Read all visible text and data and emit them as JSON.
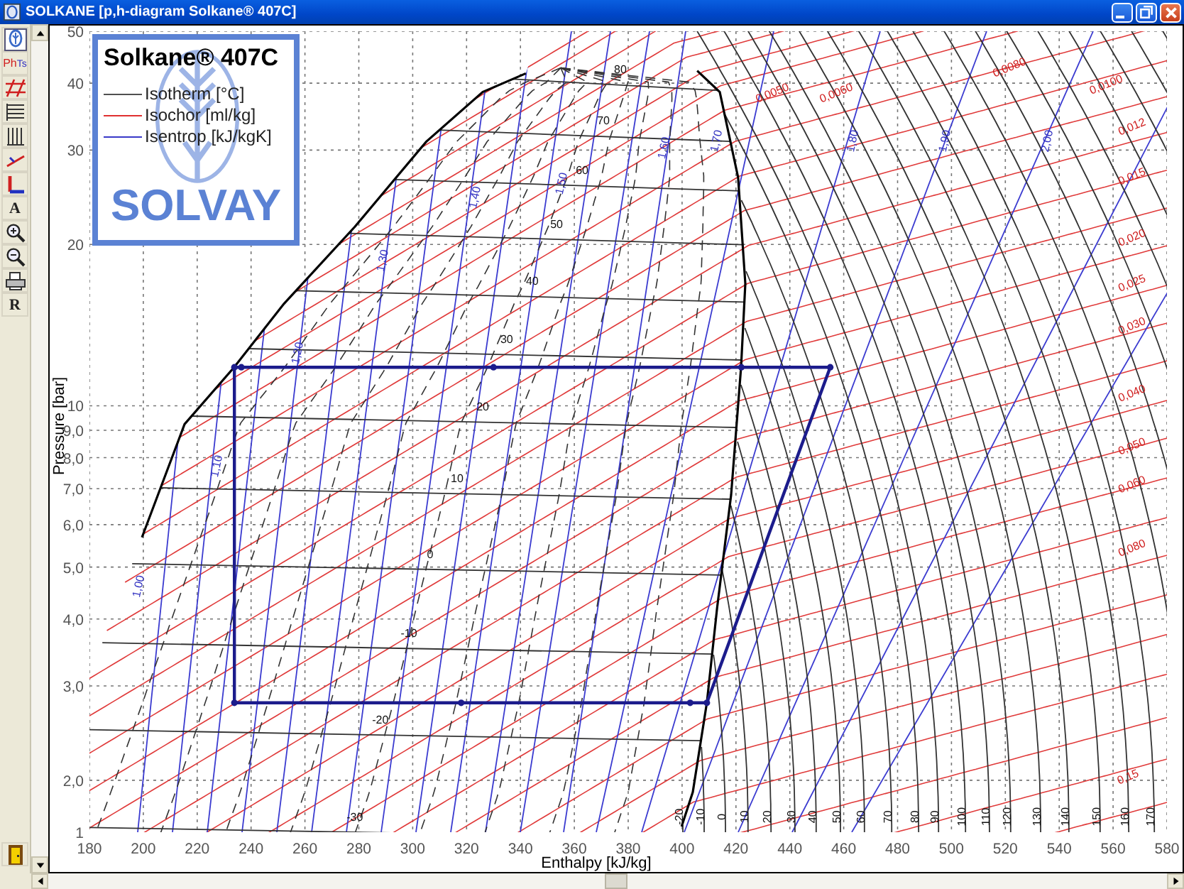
{
  "window": {
    "title": "SOLKANE [p,h-diagram Solkane® 407C]"
  },
  "toolbar": {
    "items": [
      {
        "kind": "logo"
      },
      {
        "kind": "ph_ts",
        "labels": [
          "Ph",
          "Ts"
        ]
      },
      {
        "kind": "isolines"
      },
      {
        "kind": "horizontal"
      },
      {
        "kind": "vertical"
      },
      {
        "kind": "slope"
      },
      {
        "kind": "axes"
      },
      {
        "kind": "text",
        "label": "A"
      },
      {
        "kind": "zoom_in"
      },
      {
        "kind": "zoom_out"
      },
      {
        "kind": "print"
      },
      {
        "kind": "text",
        "label": "R"
      }
    ],
    "bottom_items": [
      {
        "kind": "exit"
      }
    ]
  },
  "legend": {
    "title": "Solkane® 407C",
    "brand": "SOLVAY",
    "items": [
      {
        "label": "Isotherm [°C]",
        "color": "#505050"
      },
      {
        "label": "Isochor [ml/kg]",
        "color": "#e03030"
      },
      {
        "label": "Isentrop [kJ/kgK]",
        "color": "#3838c8"
      }
    ]
  },
  "chart": {
    "x_axis_title": "Enthalpy [kJ/kg]",
    "y_axis_title": "Pressure [bar]",
    "x_axis_labels": [
      "180",
      "200",
      "220",
      "240",
      "260",
      "280",
      "300",
      "320",
      "340",
      "360",
      "380",
      "400",
      "420",
      "440",
      "460",
      "480",
      "500",
      "520",
      "540",
      "560",
      "580"
    ],
    "y_axis_labels": [
      "50",
      "40",
      "30",
      "20",
      "10",
      "9,0",
      "8,0",
      "7,0",
      "6,0",
      "5,0",
      "4,0",
      "3,0",
      "2,0"
    ],
    "cut_tick_label": "1",
    "curve_labels": {
      "isotherms": [
        "80",
        "70",
        "60",
        "50",
        "40",
        "30",
        "20",
        "10",
        "0",
        "-10",
        "-20",
        "-30"
      ],
      "isotherm_ends": [
        "-20",
        "-10",
        "0",
        "10",
        "20",
        "30",
        "40",
        "50",
        "60",
        "70",
        "80",
        "90",
        "100",
        "110",
        "120",
        "130",
        "140",
        "150",
        "160",
        "170"
      ],
      "isentropes": [
        "1,00",
        "1,10",
        "1,20",
        "1,30",
        "1,40",
        "1,50",
        "1,60",
        "1,70",
        "1,80",
        "1,90",
        "2,00"
      ],
      "isochors": [
        "0,0050",
        "0,0060",
        "0,0080",
        "0,0100",
        "0,012",
        "0,015",
        "0,020",
        "0,025",
        "0,030",
        "0,040",
        "0,050",
        "0,060",
        "0,080",
        "0,15"
      ]
    }
  }
}
